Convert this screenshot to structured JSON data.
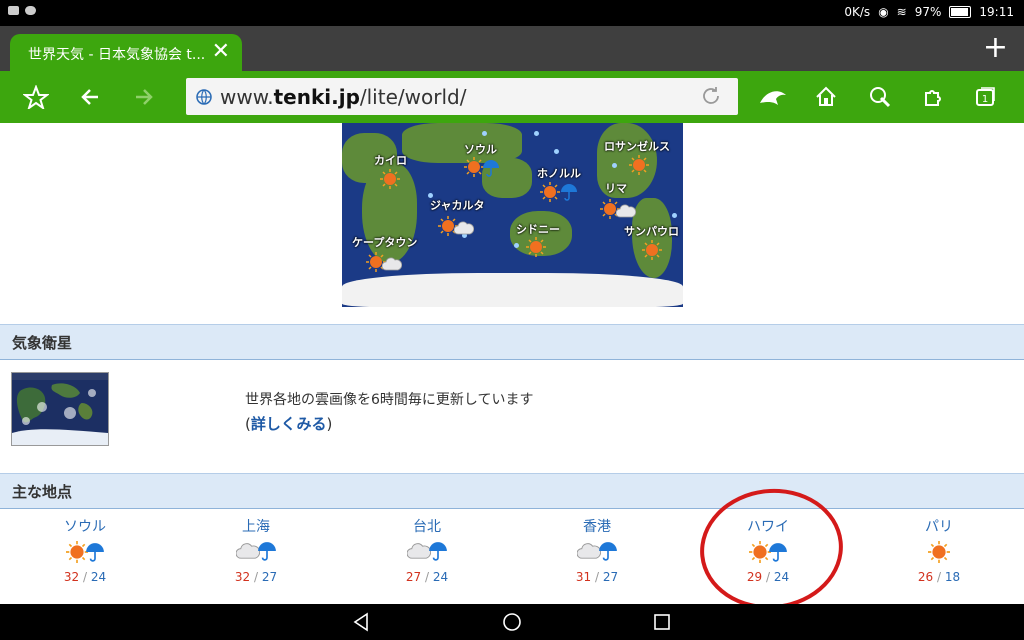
{
  "status_bar": {
    "net_speed": "0K/s",
    "battery": "97%",
    "time": "19:11"
  },
  "tab": {
    "title": "世界天気 - 日本気象協会 t...",
    "close_symbol": "✕"
  },
  "new_tab_symbol": "+",
  "url_bar": {
    "prefix": "www.",
    "domain": "tenki.jp",
    "path": "/lite/world/"
  },
  "map": {
    "cities": [
      {
        "name": "カイロ",
        "weather": "sunny"
      },
      {
        "name": "ソウル",
        "weather": "rain"
      },
      {
        "name": "ロサンゼルス",
        "weather": "sunny"
      },
      {
        "name": "ホノルル",
        "weather": "sunny-rain"
      },
      {
        "name": "リマ",
        "weather": "sunny-cloudy"
      },
      {
        "name": "ジャカルタ",
        "weather": "sunny-cloudy"
      },
      {
        "name": "シドニー",
        "weather": "sunny"
      },
      {
        "name": "サンパウロ",
        "weather": "sunny"
      },
      {
        "name": "ケープタウン",
        "weather": "sunny-cloudy"
      }
    ]
  },
  "satellite": {
    "heading": "気象衛星",
    "description": "世界各地の雲画像を6時間毎に更新しています",
    "link_open": "(",
    "link_text": "詳しくみる",
    "link_close": ")"
  },
  "major": {
    "heading": "主な地点",
    "cities": [
      {
        "name": "ソウル",
        "high": "32",
        "low": "24",
        "icon1": "sun-icon",
        "icon2": "umbrella-icon"
      },
      {
        "name": "上海",
        "high": "32",
        "low": "27",
        "icon1": "cloud-icon",
        "icon2": "umbrella-icon"
      },
      {
        "name": "台北",
        "high": "27",
        "low": "24",
        "icon1": "cloud-icon",
        "icon2": "umbrella-icon"
      },
      {
        "name": "香港",
        "high": "31",
        "low": "27",
        "icon1": "cloud-icon",
        "icon2": "umbrella-icon"
      },
      {
        "name": "ハワイ",
        "high": "29",
        "low": "24",
        "icon1": "sun-icon",
        "icon2": "umbrella-icon"
      },
      {
        "name": "パリ",
        "high": "26",
        "low": "18",
        "icon1": "sun-icon",
        "icon2": ""
      }
    ],
    "separator": "/"
  },
  "colors": {
    "browser_green": "#3da60e",
    "link_blue": "#1f5aa6",
    "high_temp": "#d2321e",
    "low_temp": "#2a6bb5",
    "annotation_red": "#d41a1a"
  }
}
